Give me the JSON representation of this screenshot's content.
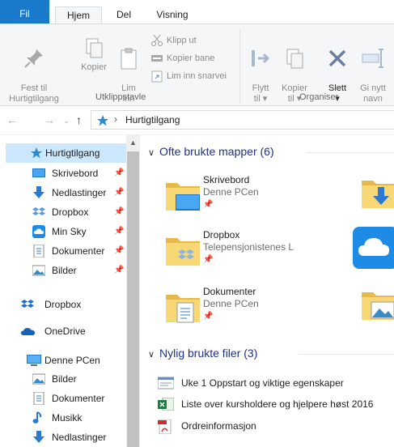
{
  "tabs": {
    "file": "Fil",
    "home": "Hjem",
    "share": "Del",
    "view": "Visning"
  },
  "ribbon": {
    "pin": "Fest til\nHurtigtilgang",
    "copy": "Kopier",
    "paste": "Lim\ninn",
    "cut": "Klipp ut",
    "copy_path": "Kopier bane",
    "paste_shortcut": "Lim inn snarvei",
    "clipboard_group": "Utklippstavle",
    "move_to": "Flytt\ntil ▾",
    "copy_to": "Kopier\ntil ▾",
    "delete": "Slett\n▾",
    "rename": "Gi nytt\nnavn",
    "organize_group": "Organiser"
  },
  "address": {
    "path": "Hurtigtilgang"
  },
  "nav": {
    "quick_access": "Hurtigtilgang",
    "desktop": "Skrivebord",
    "downloads": "Nedlastinger",
    "dropbox_pinned": "Dropbox",
    "min_sky": "Min Sky",
    "documents": "Dokumenter",
    "pictures": "Bilder",
    "dropbox": "Dropbox",
    "onedrive": "OneDrive",
    "this_pc": "Denne PCen",
    "pc_pictures": "Bilder",
    "pc_documents": "Dokumenter",
    "pc_music": "Musikk",
    "pc_downloads": "Nedlastinger"
  },
  "frequent": {
    "header": "Ofte brukte mapper (6)",
    "items": [
      {
        "name": "Skrivebord",
        "location": "Denne PCen"
      },
      {
        "name": "Dropbox",
        "location": "Telepensjonistenes L"
      },
      {
        "name": "Dokumenter",
        "location": "Denne PCen"
      }
    ]
  },
  "recent": {
    "header": "Nylig brukte filer (3)",
    "items": [
      {
        "name": "Uke 1 Oppstart og viktige egenskaper"
      },
      {
        "name": "Liste over kursholdere og hjelpere høst 2016"
      },
      {
        "name": "Ordreinformasjon"
      }
    ]
  },
  "colors": {
    "accent": "#1979ca",
    "selection": "#cce8ff",
    "heading": "#1e3287",
    "folder": "#f8d775"
  }
}
